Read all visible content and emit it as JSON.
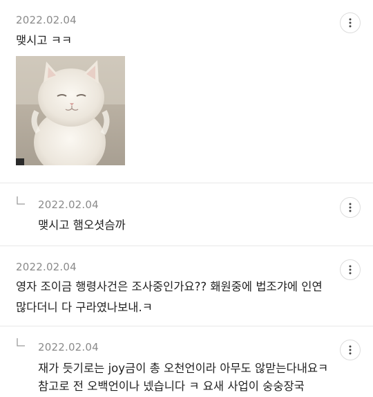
{
  "comments": [
    {
      "date": "2022.02.04",
      "lines": [
        "맺시고 ㅋㅋ"
      ],
      "attachment_icon": "white-persian-cat-photo",
      "more_icon": "vertical-dots-icon"
    },
    {
      "date": "2022.02.04",
      "lines": [
        "맺시고 햄오셧슴까"
      ],
      "is_reply": true,
      "more_icon": "vertical-dots-icon"
    },
    {
      "date": "2022.02.04",
      "lines": [
        "영자 조이금 행령사건은 조사중인가요?? 홰원중에 법조갸에 인연",
        "많다더니 다 구라였나보내.ㅋ"
      ],
      "more_icon": "vertical-dots-icon"
    },
    {
      "date": "2022.02.04",
      "lines": [
        "재가 듯기로는 joy금이 총 오천언이라 아무도 않맏는다내요ㅋ",
        "참고로 전 오백언이나 넸습니다 ㅋ 요새 사업이 숭숭장국"
      ],
      "is_reply": true,
      "more_icon": "vertical-dots-icon"
    }
  ],
  "colors": {
    "date": "#8a8a8a",
    "text": "#1f1f1f",
    "divider": "#e8e8e8"
  }
}
